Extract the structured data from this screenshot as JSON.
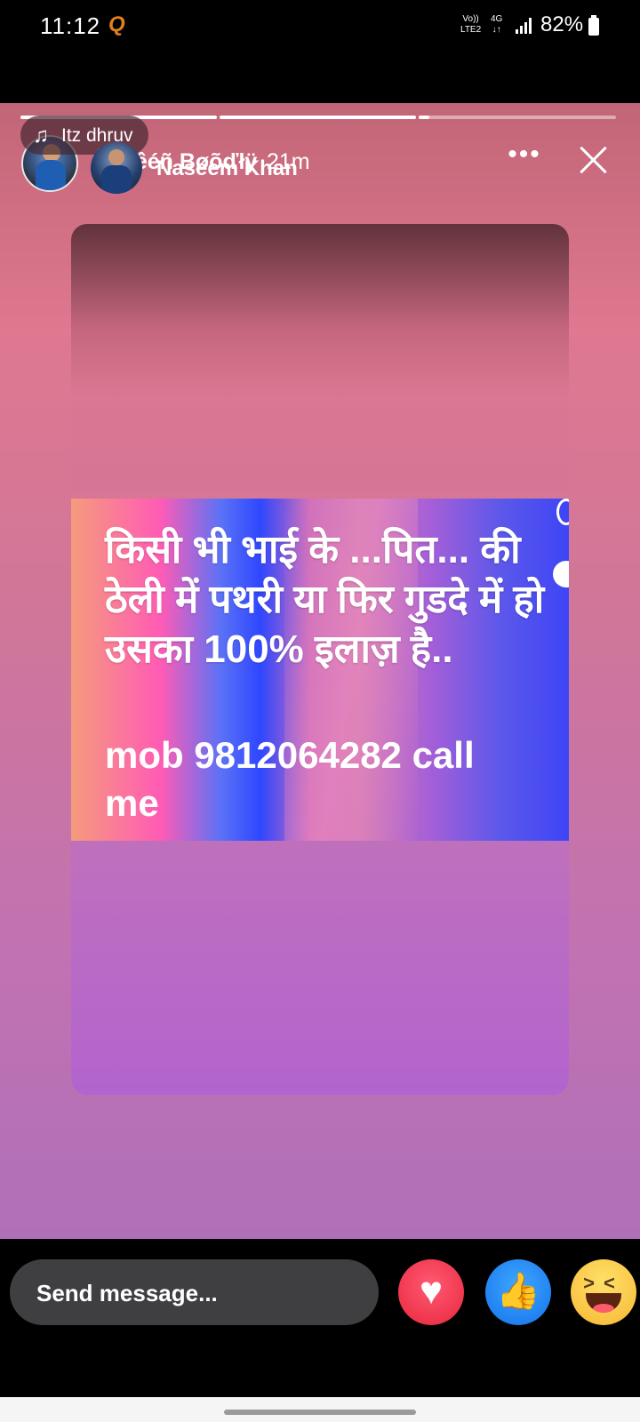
{
  "status_bar": {
    "time": "11:12",
    "app_icon": "Q",
    "network_top": "Vo))",
    "network_bottom": "LTE2",
    "network_type": "4G",
    "network_arrows": "↓↑",
    "battery": "82%"
  },
  "story": {
    "progress_segments": 3,
    "user_name": "Šāĥêéñ Bøõďłÿ",
    "time_ago": "21m",
    "more_label": "•••",
    "music_label": "Itz dhruv",
    "music_icon": "music-note-icon",
    "poster_name": "Naseem Khan",
    "shared_image": {
      "hindi_lines": [
        "किसी भी भाई के ...पित... की",
        "ठेली में पथरी या फिर गुडदे में हो",
        "उसका 100% इलाज़ है.."
      ],
      "phone_line_1": "mob 9812064282 call",
      "phone_line_2": "me"
    }
  },
  "reply_bar": {
    "placeholder": "Send message...",
    "reactions": [
      "love-reaction-icon",
      "like-reaction-icon",
      "haha-reaction-icon"
    ]
  },
  "colors": {
    "love": "#e8263c",
    "like": "#1472ea",
    "haha": "#f7b733",
    "input_bg": "#3f3f41"
  }
}
